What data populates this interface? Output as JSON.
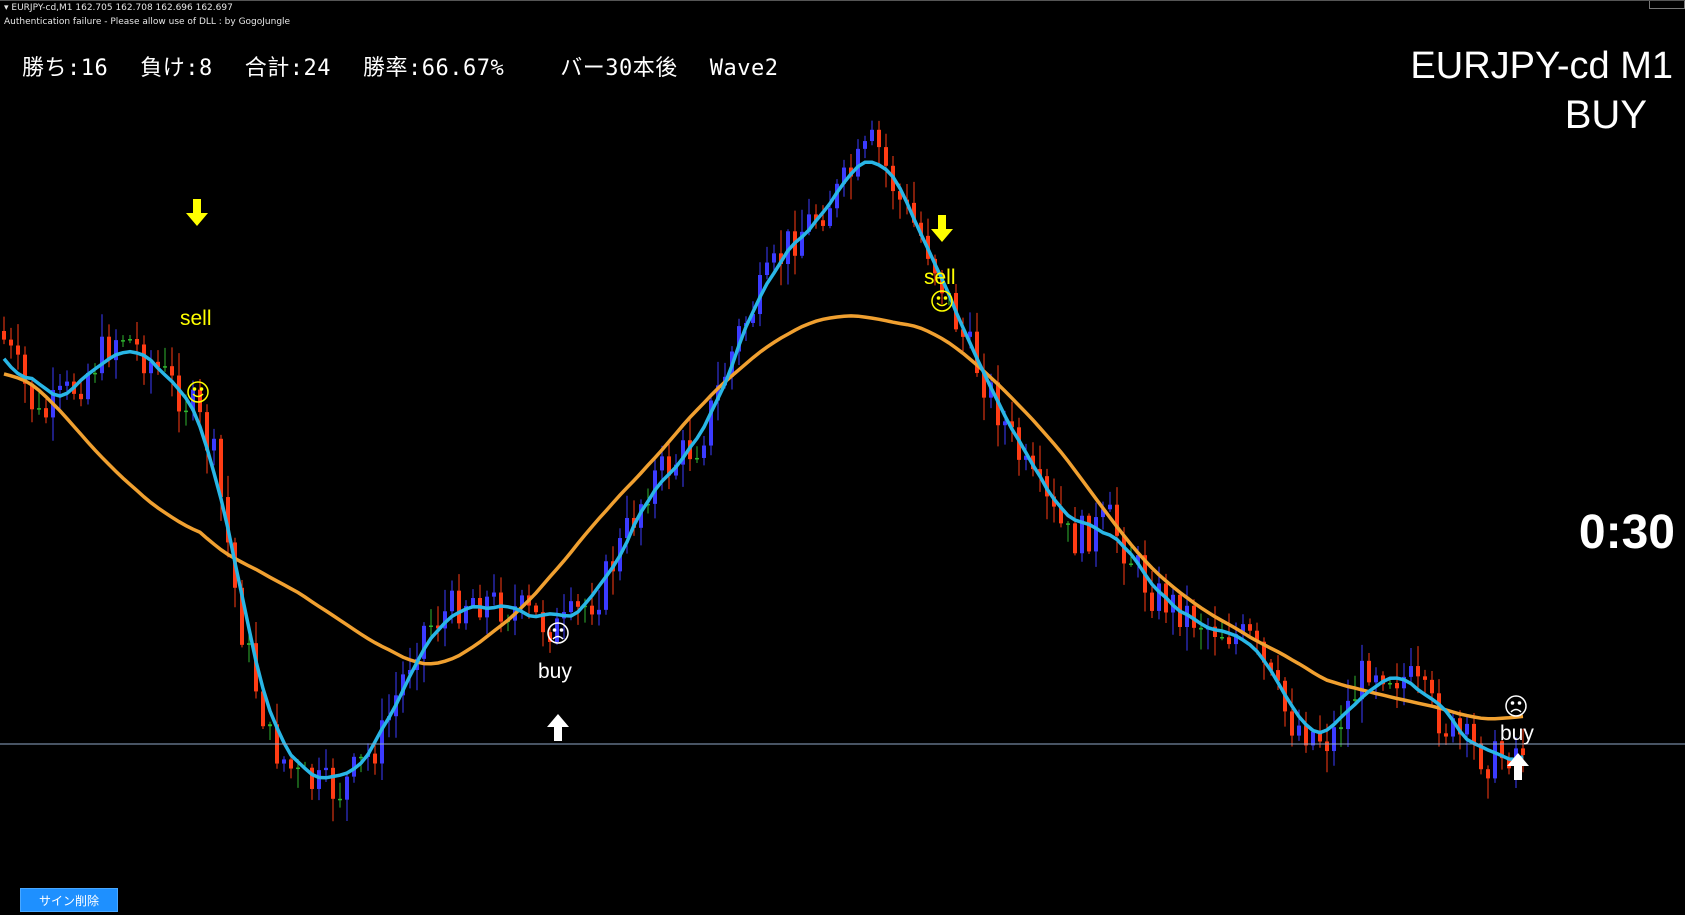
{
  "window": {
    "title_line": "EURJPY-cd,M1  162.705 162.708 162.696 162.697",
    "auth_message": "Authentication failure - Please allow use of DLL : by GogoJungle"
  },
  "stats": {
    "wins": "勝ち:16",
    "losses": "負け:8",
    "total": "合計:24",
    "win_rate": "勝率:66.67%",
    "bars_after": "バー30本後",
    "wave": "Wave2"
  },
  "symbol": "EURJPY-cd M1",
  "current_signal": "BUY",
  "countdown": "0:30",
  "delete_signs_button": "サイン削除",
  "colors": {
    "background": "#000000",
    "bull_candle": "#3b3bff",
    "bear_candle": "#ff3c14",
    "doji_candle": "#2fb52f",
    "fast_ma": "#29b6e6",
    "slow_ma": "#f0a030",
    "sell_arrow": "#ffff00",
    "buy_arrow": "#ffffff",
    "price_line": "#8fa8c8"
  },
  "signals": [
    {
      "type": "sell",
      "label": "sell",
      "result": "win",
      "icon": "smile-face-icon"
    },
    {
      "type": "sell",
      "label": "sell",
      "result": "win",
      "icon": "smile-face-icon"
    },
    {
      "type": "buy",
      "label": "buy",
      "result": "loss",
      "icon": "sad-face-icon"
    },
    {
      "type": "buy",
      "label": "buy",
      "result": "loss",
      "icon": "sad-face-icon"
    }
  ]
}
